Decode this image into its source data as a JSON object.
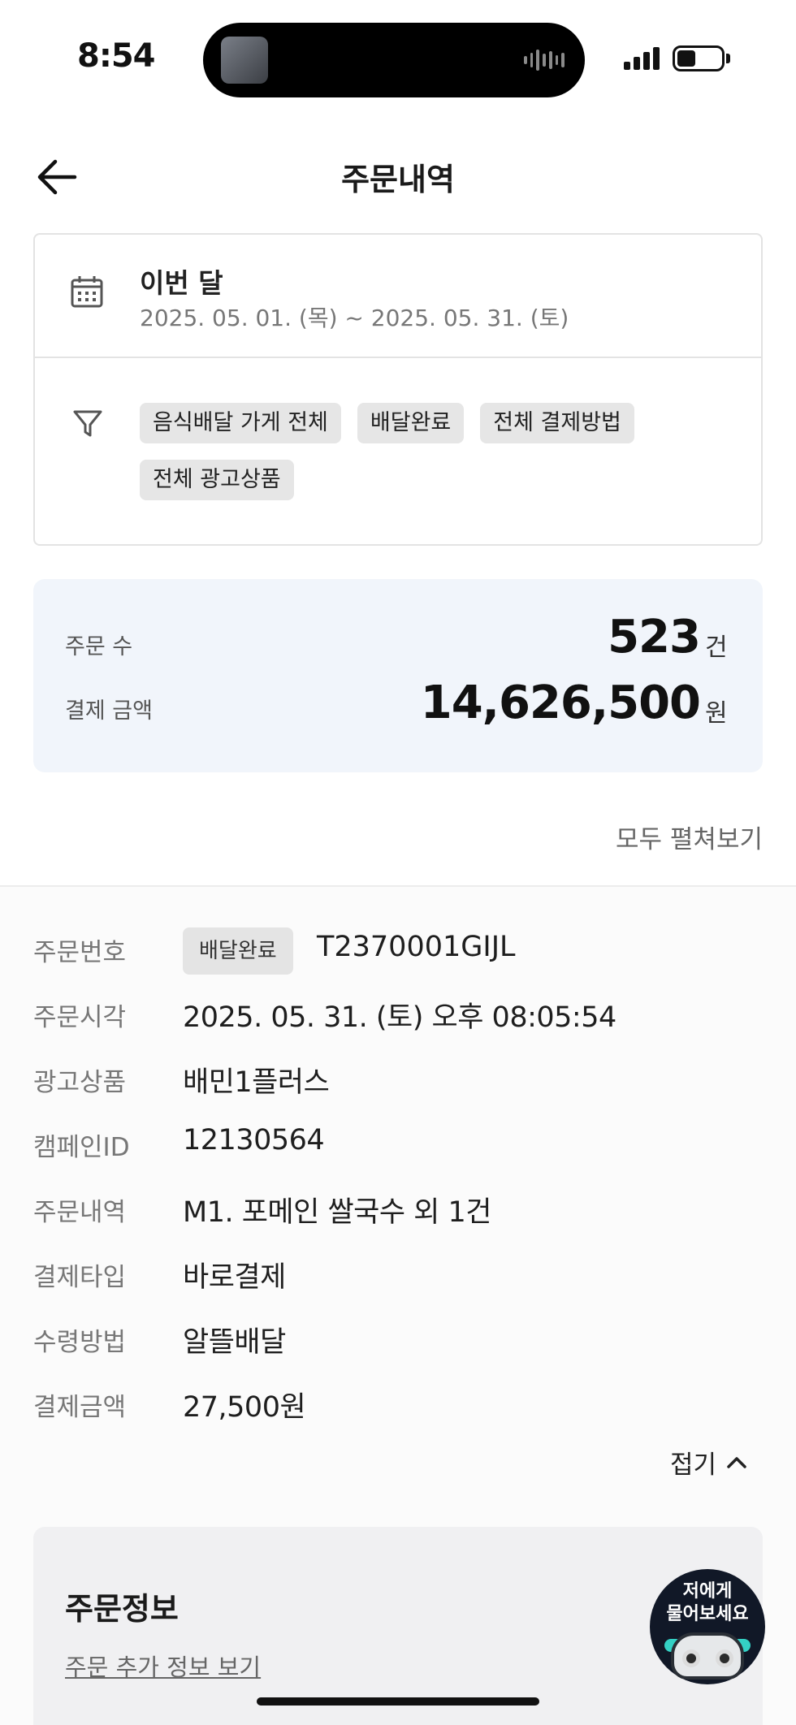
{
  "status_bar": {
    "time": "8:54"
  },
  "header": {
    "title": "주문내역"
  },
  "filter": {
    "period_title": "이번 달",
    "period_range": "2025. 05. 01. (목) ~ 2025. 05. 31. (토)",
    "chips": [
      "음식배달 가게 전체",
      "배달완료",
      "전체 결제방법",
      "전체 광고상품"
    ]
  },
  "summary": {
    "count_label": "주문 수",
    "count_value": "523",
    "count_unit": "건",
    "amount_label": "결제 금액",
    "amount_value": "14,626,500",
    "amount_unit": "원"
  },
  "expand_all_label": "모두 펼쳐보기",
  "order": {
    "status_chip": "배달완료",
    "rows": [
      {
        "label": "주문번호",
        "value": "T2370001GIJL"
      },
      {
        "label": "주문시각",
        "value": "2025. 05. 31. (토) 오후 08:05:54"
      },
      {
        "label": "광고상품",
        "value": "배민1플러스"
      },
      {
        "label": "캠페인ID",
        "value": "12130564"
      },
      {
        "label": "주문내역",
        "value": "M1. 포메인 쌀국수 외 1건"
      },
      {
        "label": "결제타입",
        "value": "바로결제"
      },
      {
        "label": "수령방법",
        "value": "알뜰배달"
      },
      {
        "label": "결제금액",
        "value": "27,500원"
      }
    ],
    "collapse_label": "접기"
  },
  "info": {
    "title": "주문정보",
    "link": "주문 추가 정보 보기"
  },
  "chatbot": {
    "line1": "저에게",
    "line2": "물어보세요"
  },
  "colors": {
    "summary_bg": "#f1f5fb",
    "chip_bg": "#e6e6e6",
    "bot_accent": "#34d1c5"
  }
}
